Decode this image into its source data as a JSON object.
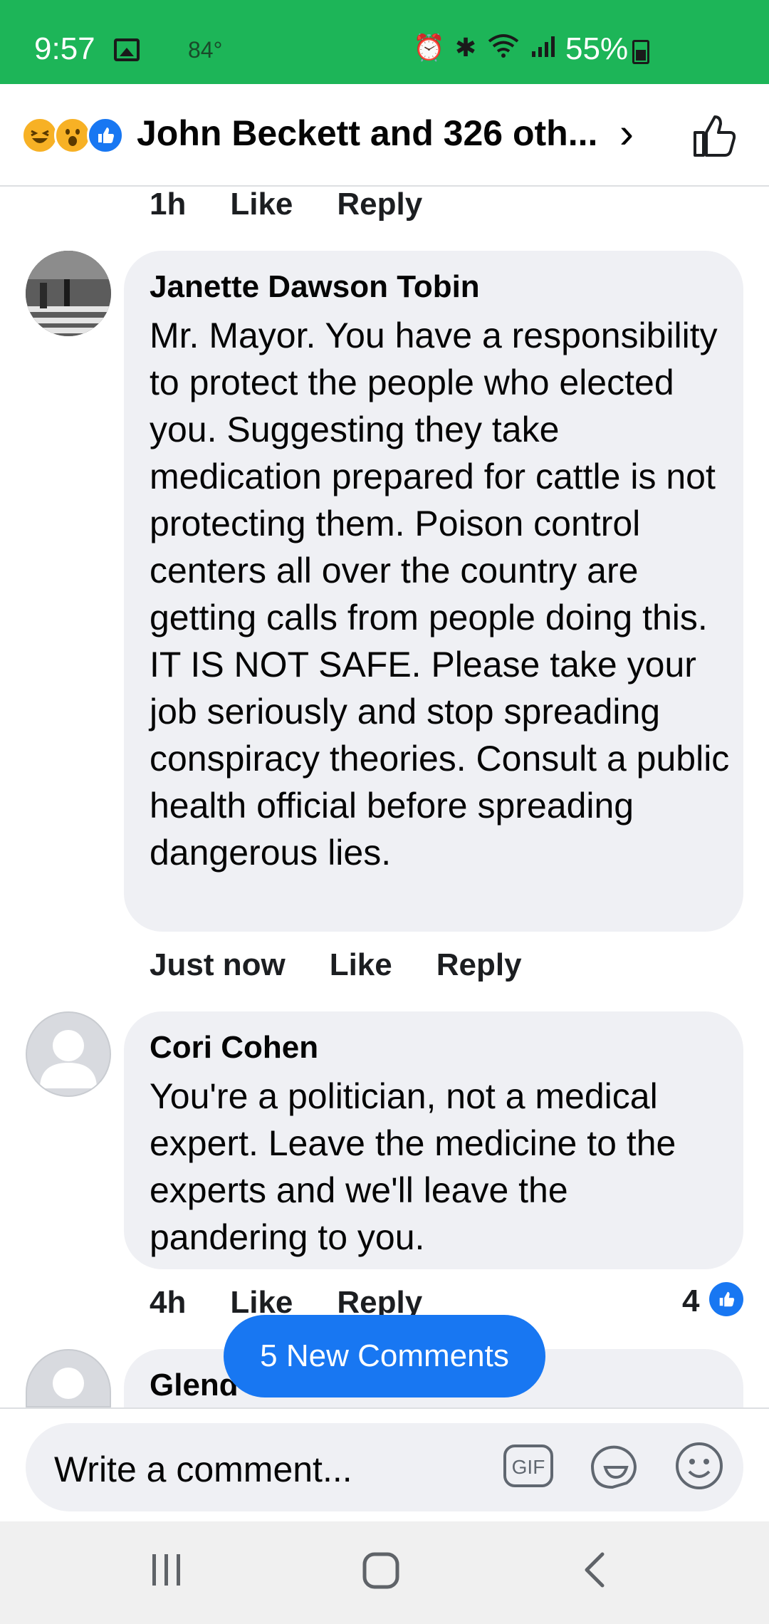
{
  "status_bar": {
    "time": "9:57",
    "temperature": "84°",
    "battery": "55%"
  },
  "header": {
    "title": "John Beckett and 326 oth...",
    "reactions": [
      "haha",
      "wow",
      "like"
    ]
  },
  "comments": [
    {
      "meta": {
        "time": "1h",
        "like": "Like",
        "reply": "Reply"
      }
    },
    {
      "author": "Janette Dawson Tobin",
      "text": "Mr. Mayor. You have a responsibility to protect the people who elected you. Suggesting they take medication prepared for cattle is not protecting them. Poison control centers all over the country are getting calls from people doing this. IT IS NOT SAFE.  Please take your job seriously and stop spreading conspiracy theories. Consult a public health official before spreading dangerous lies.",
      "meta": {
        "time": "Just now",
        "like": "Like",
        "reply": "Reply"
      }
    },
    {
      "author": "Cori Cohen",
      "text": "You're a politician, not a medical expert. Leave the medicine to the experts and we'll leave the pandering to you.",
      "meta": {
        "time": "4h",
        "like": "Like",
        "reply": "Reply"
      },
      "like_count": "4"
    },
    {
      "author": "Glend"
    }
  ],
  "new_comments_label": "5 New Comments",
  "composer": {
    "placeholder": "Write a comment...",
    "gif_label": "GIF"
  },
  "colors": {
    "status_bar": "#1db558",
    "accent": "#1877f2",
    "bubble": "#eff0f4"
  }
}
